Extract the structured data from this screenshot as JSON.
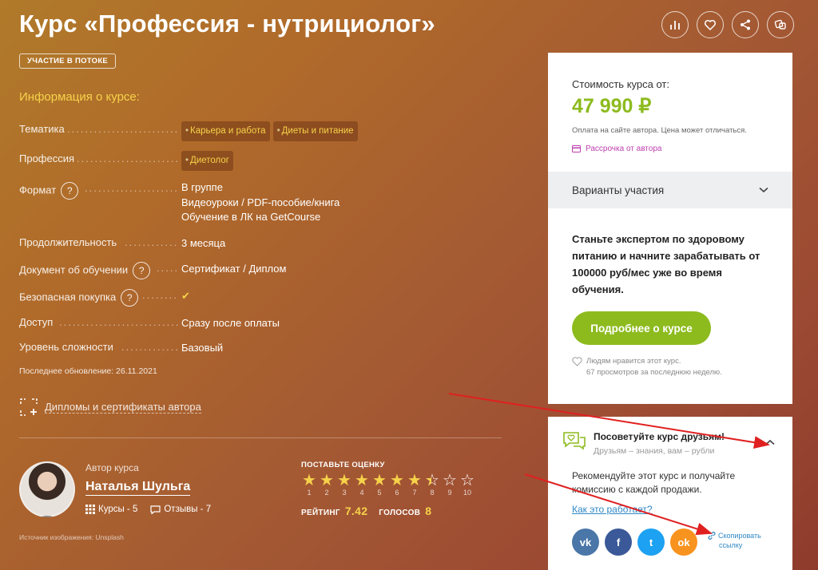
{
  "header": {
    "title": "Курс «Профессия - нутрициолог»",
    "badge": "УЧАСТИЕ В ПОТОКЕ"
  },
  "top_icons": [
    "bar-chart-icon",
    "heart-icon",
    "share-icon",
    "dice-icon"
  ],
  "info": {
    "title": "Информация о курсе:",
    "rows": [
      {
        "label": "Тематика",
        "tags": [
          "Карьера и работа",
          "Диеты и питание"
        ]
      },
      {
        "label": "Профессия",
        "tags": [
          "Диетолог"
        ]
      },
      {
        "label": "Формат",
        "help": "?",
        "lines": [
          "В группе",
          "Видеоуроки / PDF-пособие/книга",
          "Обучение в ЛК на GetCourse"
        ]
      },
      {
        "label": "Продолжительность",
        "value": "3 месяца"
      },
      {
        "label": "Документ об обучении",
        "help": "?",
        "value": "Сертификат / Диплом"
      },
      {
        "label": "Безопасная покупка",
        "help": "?",
        "value": "✔"
      },
      {
        "label": "Доступ",
        "value": "Сразу после оплаты"
      },
      {
        "label": "Уровень сложности",
        "value": "Базовый"
      }
    ],
    "updated": "Последнее обновление: 26.11.2021",
    "diplomas": "Дипломы и сертификаты автора"
  },
  "author": {
    "label": "Автор курса",
    "name": "Наталья Шульга",
    "courses": "Курсы - 5",
    "reviews": "Отзывы - 7"
  },
  "rating": {
    "heading": "ПОСТАВЬТЕ ОЦЕНКУ",
    "max": 10,
    "filled": 7.42,
    "numbers": [
      "1",
      "2",
      "3",
      "4",
      "5",
      "6",
      "7",
      "8",
      "9",
      "10"
    ],
    "rating_label": "РЕЙТИНГ",
    "rating_value": "7.42",
    "votes_label": "ГОЛОСОВ",
    "votes_value": "8"
  },
  "source": "Источник изображения: Unsplash",
  "price_card": {
    "label": "Стоимость курса от:",
    "price": "47 990 ₽",
    "note": "Оплата на сайте автора. Цена может отличаться.",
    "installment": "Рассрочка от автора",
    "variants": "Варианты участия",
    "pitch": "Станьте экспертом по здоровому питанию и начните зарабатывать от 100000 руб/мес уже во время обучения.",
    "button": "Подробнее о курсе",
    "likes_1": "Людям нравится этот курс.",
    "likes_2": "67 просмотров за последнюю неделю."
  },
  "share_card": {
    "title": "Посоветуйте курс друзьям!",
    "subtitle": "Друзьям – знания, вам – рубли",
    "text": "Рекомендуйте этот курс и получайте комиссию с каждой продажи.",
    "how": "Как это работает?",
    "socials": [
      {
        "name": "vk",
        "label": "vk",
        "color": "#4a76a8"
      },
      {
        "name": "facebook",
        "label": "f",
        "color": "#3b5998"
      },
      {
        "name": "twitter",
        "label": "t",
        "color": "#1da1f2"
      },
      {
        "name": "odnoklassniki",
        "label": "ok",
        "color": "#f7931e"
      }
    ],
    "copy_1": "Скопировать",
    "copy_2": "ссылку"
  },
  "colors": {
    "accent_green": "#8dbb1e",
    "accent_yellow": "#f6d24a",
    "link_blue": "#2f88c5",
    "annotation_red": "#e02020"
  }
}
